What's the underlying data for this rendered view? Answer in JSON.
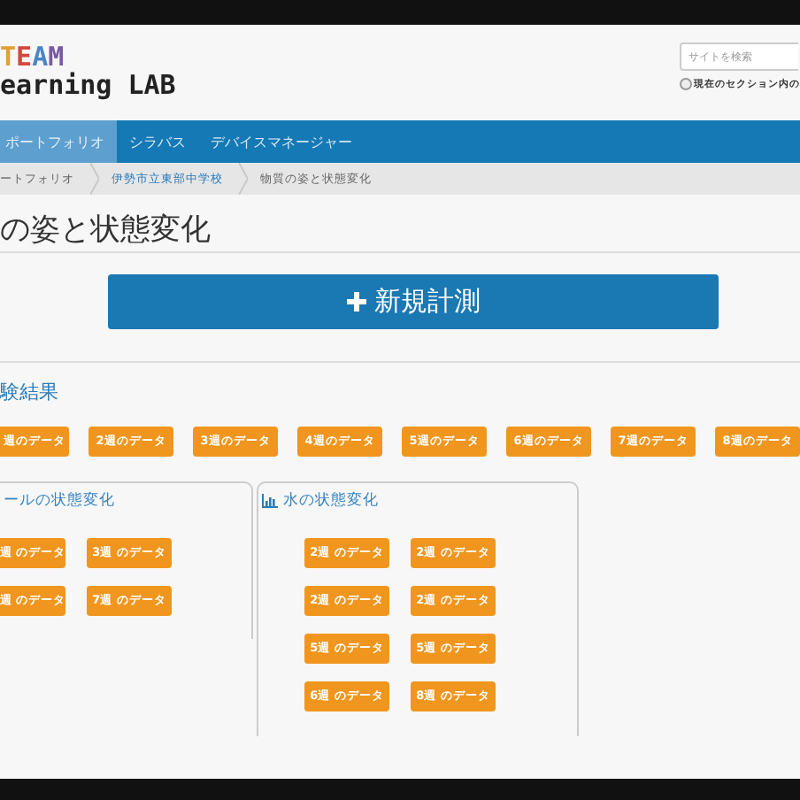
{
  "logo": {
    "line1": "TEAM",
    "line2": "earning LAB"
  },
  "search": {
    "placeholder": "サイトを検索",
    "option": {
      "label": "現在のセクション内の",
      "checked": false
    }
  },
  "nav": [
    {
      "label": "ポートフォリオ",
      "selected": true
    },
    {
      "label": "シラバス",
      "selected": false
    },
    {
      "label": "デバイスマネージャー",
      "selected": false
    }
  ],
  "breadcrumbs": [
    {
      "label": "ートフォリオ",
      "link": false
    },
    {
      "label": "伊勢市立東部中学校",
      "link": true
    },
    {
      "label": "物質の姿と状態変化",
      "link": false
    }
  ],
  "title": "の姿と状態変化",
  "new_button": {
    "label": "新規計測"
  },
  "results": {
    "heading": "験結果",
    "buttons": [
      "週のデータ",
      "2週のデータ",
      "3週のデータ",
      "4週のデータ",
      "5週のデータ",
      "6週のデータ",
      "7週のデータ",
      "8週のデータ"
    ]
  },
  "panels": [
    {
      "heading": "ールの状態変化",
      "chart_icon": false,
      "buttons": [
        "週 のデータ",
        "3週 のデータ",
        "週 のデータ",
        "7週 のデータ"
      ]
    },
    {
      "heading": "水の状態変化",
      "chart_icon": true,
      "buttons": [
        "2週 のデータ",
        "2週 のデータ",
        "2週 のデータ",
        "2週 のデータ",
        "5週 のデータ",
        "5週 のデータ",
        "6週 のデータ",
        "8週 のデータ"
      ]
    }
  ]
}
